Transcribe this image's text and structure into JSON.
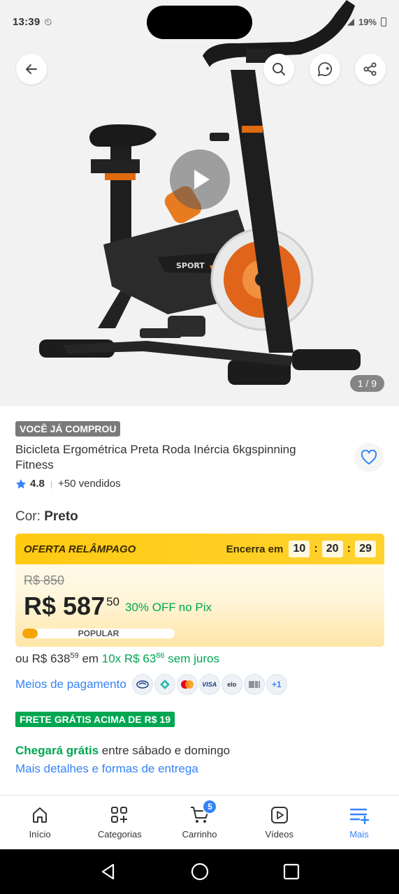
{
  "status_bar": {
    "time": "13:39",
    "battery": "19%"
  },
  "gallery": {
    "counter": "1 / 9"
  },
  "product": {
    "badge": "VOCÊ JÁ COMPROU",
    "title": "Bicicleta Ergométrica Preta Roda Inércia 6kgspinning Fitness",
    "rating": "4.8",
    "sold": "+50 vendidos",
    "color_label": "Cor:",
    "color_value": "Preto"
  },
  "offer": {
    "title": "OFERTA RELÂMPAGO",
    "ends_label": "Encerra em",
    "hours": "10",
    "minutes": "20",
    "seconds": "29",
    "old_price": "R$ 850",
    "price": "R$ 587",
    "cents": "50",
    "discount": "30% OFF",
    "pix": "no Pix",
    "popular_label": "POPULAR",
    "popular_level": 0.1
  },
  "installments": {
    "prefix": "ou R$ 638",
    "prefix_cents": "59",
    "in": "em",
    "count": "10x R$ 63",
    "count_cents": "86",
    "interest": "sem juros"
  },
  "payment": {
    "link": "Meios de pagamento",
    "icons": [
      "mercadopago-icon",
      "pix-icon",
      "mastercard-icon",
      "visa-icon",
      "elo-icon",
      "boleto-icon"
    ],
    "more": "+1"
  },
  "shipping": {
    "free_badge": "FRETE GRÁTIS ACIMA DE R$ 19",
    "arrival_bold": "Chegará grátis",
    "arrival_rest": "entre sábado e domingo",
    "details_link": "Mais detalhes e formas de entrega"
  },
  "nav": {
    "items": [
      {
        "label": "Início",
        "icon": "home-icon"
      },
      {
        "label": "Categorias",
        "icon": "categories-icon"
      },
      {
        "label": "Carrinho",
        "icon": "cart-icon",
        "badge": "5"
      },
      {
        "label": "Vídeos",
        "icon": "video-icon"
      },
      {
        "label": "Mais",
        "icon": "menu-icon",
        "active": true
      }
    ]
  },
  "colors": {
    "accent": "#3483fa",
    "green": "#00a650",
    "offer_yellow": "#ffcf1f"
  }
}
